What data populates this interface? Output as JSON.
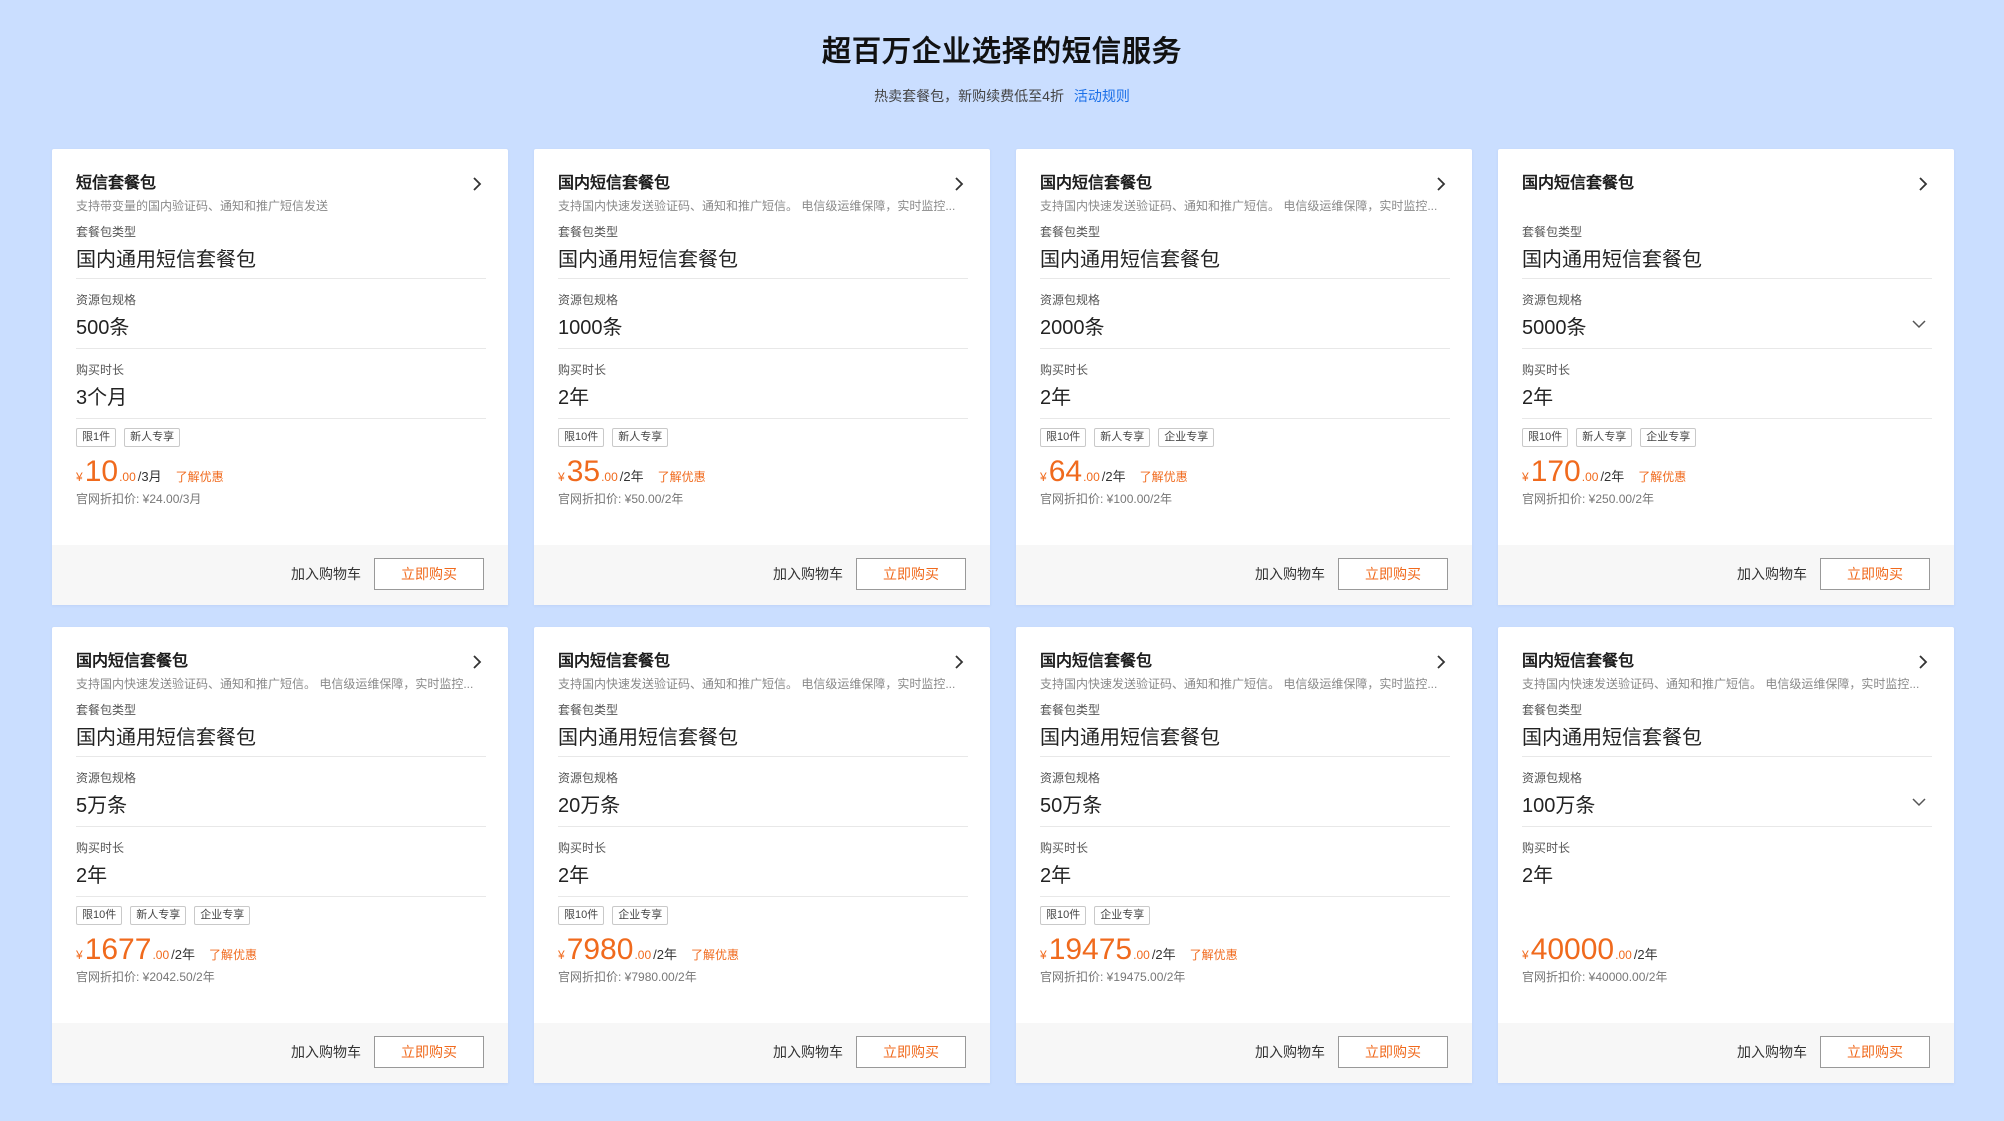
{
  "header": {
    "title": "超百万企业选择的短信服务",
    "subtitle": "热卖套餐包，新购续费低至4折",
    "rule_link": "活动规则"
  },
  "labels": {
    "type": "套餐包类型",
    "spec": "资源包规格",
    "duration": "购买时长",
    "learn_more": "了解优惠",
    "add_cart": "加入购物车",
    "buy_now": "立即购买",
    "yen": "¥"
  },
  "cards": [
    {
      "title": "短信套餐包",
      "desc": "支持带变量的国内验证码、通知和推广短信发送",
      "type": "国内通用短信套餐包",
      "spec": "500条",
      "duration": "3个月",
      "tags": [
        "限1件",
        "新人专享"
      ],
      "price_int": "10",
      "price_dec": ".00",
      "price_unit": "/3月",
      "original": "官网折扣价: ¥24.00/3月",
      "learn": true,
      "dropdown": false
    },
    {
      "title": "国内短信套餐包",
      "desc": "支持国内快速发送验证码、通知和推广短信。 电信级运维保障，实时监控...",
      "type": "国内通用短信套餐包",
      "spec": "1000条",
      "duration": "2年",
      "tags": [
        "限10件",
        "新人专享"
      ],
      "price_int": "35",
      "price_dec": ".00",
      "price_unit": "/2年",
      "original": "官网折扣价: ¥50.00/2年",
      "learn": true,
      "dropdown": false
    },
    {
      "title": "国内短信套餐包",
      "desc": "支持国内快速发送验证码、通知和推广短信。 电信级运维保障，实时监控...",
      "type": "国内通用短信套餐包",
      "spec": "2000条",
      "duration": "2年",
      "tags": [
        "限10件",
        "新人专享",
        "企业专享"
      ],
      "price_int": "64",
      "price_dec": ".00",
      "price_unit": "/2年",
      "original": "官网折扣价: ¥100.00/2年",
      "learn": true,
      "dropdown": false
    },
    {
      "title": "国内短信套餐包",
      "desc": "",
      "type": "国内通用短信套餐包",
      "spec": "5000条",
      "duration": "2年",
      "tags": [
        "限10件",
        "新人专享",
        "企业专享"
      ],
      "price_int": "170",
      "price_dec": ".00",
      "price_unit": "/2年",
      "original": "官网折扣价: ¥250.00/2年",
      "learn": true,
      "dropdown": true
    },
    {
      "title": "国内短信套餐包",
      "desc": "支持国内快速发送验证码、通知和推广短信。 电信级运维保障，实时监控...",
      "type": "国内通用短信套餐包",
      "spec": "5万条",
      "duration": "2年",
      "tags": [
        "限10件",
        "新人专享",
        "企业专享"
      ],
      "price_int": "1677",
      "price_dec": ".00",
      "price_unit": "/2年",
      "original": "官网折扣价: ¥2042.50/2年",
      "learn": true,
      "dropdown": false
    },
    {
      "title": "国内短信套餐包",
      "desc": "支持国内快速发送验证码、通知和推广短信。 电信级运维保障，实时监控...",
      "type": "国内通用短信套餐包",
      "spec": "20万条",
      "duration": "2年",
      "tags": [
        "限10件",
        "企业专享"
      ],
      "price_int": "7980",
      "price_dec": ".00",
      "price_unit": "/2年",
      "original": "官网折扣价: ¥7980.00/2年",
      "learn": true,
      "dropdown": false
    },
    {
      "title": "国内短信套餐包",
      "desc": "支持国内快速发送验证码、通知和推广短信。 电信级运维保障，实时监控...",
      "type": "国内通用短信套餐包",
      "spec": "50万条",
      "duration": "2年",
      "tags": [
        "限10件",
        "企业专享"
      ],
      "price_int": "19475",
      "price_dec": ".00",
      "price_unit": "/2年",
      "original": "官网折扣价: ¥19475.00/2年",
      "learn": true,
      "dropdown": false
    },
    {
      "title": "国内短信套餐包",
      "desc": "支持国内快速发送验证码、通知和推广短信。 电信级运维保障，实时监控...",
      "type": "国内通用短信套餐包",
      "spec": "100万条",
      "duration": "2年",
      "tags": [],
      "price_int": "40000",
      "price_dec": ".00",
      "price_unit": "/2年",
      "original": "官网折扣价: ¥40000.00/2年",
      "learn": false,
      "dropdown": true
    }
  ],
  "colors": {
    "page_bg": "#cadeff",
    "price": "#f06a1d",
    "link": "#1a6fe8"
  },
  "icons": {
    "card_arrow": "chevron-right-icon",
    "spec_dropdown": "chevron-down-icon"
  }
}
